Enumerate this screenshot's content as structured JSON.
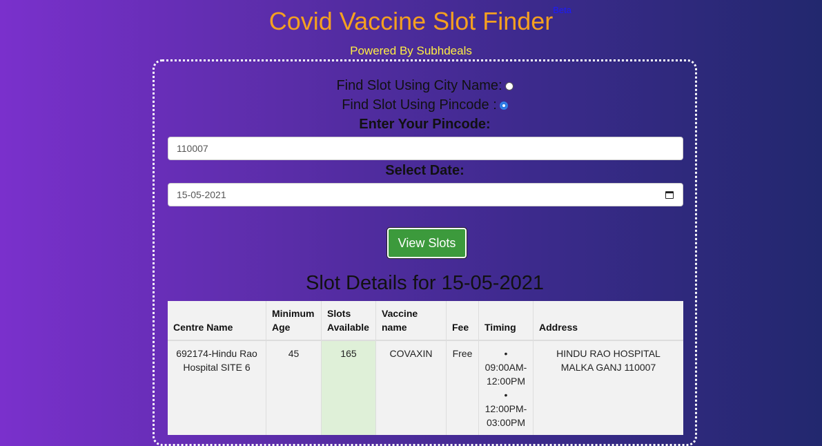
{
  "header": {
    "title": "Covid Vaccine Slot Finder",
    "beta": "Beta",
    "powered_by": "Powered By Subhdeals"
  },
  "form": {
    "option_city": "Find Slot Using City Name:",
    "option_pincode": "Find Slot Using Pincode :",
    "selected_option": "pincode",
    "pincode_label": "Enter Your Pincode:",
    "pincode_value": "110007",
    "date_label": "Select Date:",
    "date_value": "15-05-2021",
    "submit_label": "View Slots"
  },
  "results": {
    "title": "Slot Details for 15-05-2021",
    "columns": [
      "Centre Name",
      "Minimum Age",
      "Slots Available",
      "Vaccine name",
      "Fee",
      "Timing",
      "Address"
    ],
    "rows": [
      {
        "centre": "692174-Hindu Rao Hospital SITE 6",
        "min_age": "45",
        "slots": "165",
        "vaccine": "COVAXIN",
        "fee": "Free",
        "timings": [
          "09:00AM-12:00PM",
          "12:00PM-03:00PM"
        ],
        "address": "HINDU RAO HOSPITAL MALKA GANJ 110007"
      }
    ]
  }
}
